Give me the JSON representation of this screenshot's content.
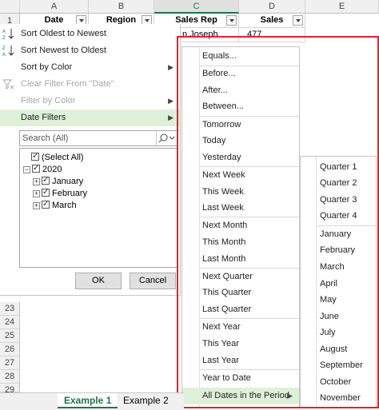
{
  "columns": [
    "A",
    "B",
    "C",
    "D",
    "E"
  ],
  "row_numbers_top": [
    "1"
  ],
  "row_numbers_bottom": [
    "23",
    "24",
    "25",
    "26",
    "27",
    "28",
    "29"
  ],
  "header_cells": {
    "date": "Date",
    "region": "Region",
    "sales_rep": "Sales Rep",
    "sales": "Sales"
  },
  "row2": {
    "sales_rep_partial": "n Joseph",
    "sales": "477"
  },
  "filter_menu": {
    "sort_oldest": "Sort Oldest to Newest",
    "sort_newest": "Sort Newest to Oldest",
    "sort_color": "Sort by Color",
    "clear_filter": "Clear Filter From \"Date\"",
    "filter_color": "Filter by Color",
    "date_filters": "Date Filters",
    "search_placeholder": "Search (All)",
    "tree": {
      "select_all": "(Select All)",
      "year": "2020",
      "months": [
        "January",
        "February",
        "March"
      ]
    },
    "ok": "OK",
    "cancel": "Cancel"
  },
  "date_filter_menu": [
    "Equals...",
    "Before...",
    "After...",
    "Between...",
    "Tomorrow",
    "Today",
    "Yesterday",
    "Next Week",
    "This Week",
    "Last Week",
    "Next Month",
    "This Month",
    "Last Month",
    "Next Quarter",
    "This Quarter",
    "Last Quarter",
    "Next Year",
    "This Year",
    "Last Year",
    "Year to Date",
    "All Dates in the Period"
  ],
  "period_menu": [
    "Quarter 1",
    "Quarter 2",
    "Quarter 3",
    "Quarter 4",
    "January",
    "February",
    "March",
    "April",
    "May",
    "June",
    "July",
    "August",
    "September",
    "October",
    "November"
  ],
  "sheet_tabs": [
    "Example 1",
    "Example 2"
  ],
  "colors": {
    "highlight": "#dff0d8",
    "accent": "#217346",
    "callout": "#e0242c"
  }
}
